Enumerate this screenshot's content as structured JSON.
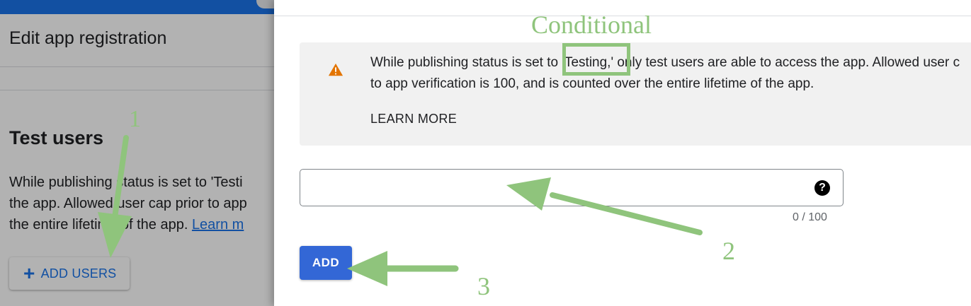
{
  "left_page": {
    "title": "Edit app registration",
    "section_title": "Test users",
    "description_lines": [
      "While publishing status is set to 'Testi",
      "the app. Allowed user cap prior to app",
      "the entire lifetime of the app. "
    ],
    "learn_more_link": "Learn m",
    "add_users_label": "ADD USERS"
  },
  "drawer": {
    "notice_lines": [
      "While publishing status is set to 'Testing,' only test users are able to access the app. Allowed user c",
      "to app verification is 100, and is counted over the entire lifetime of the app."
    ],
    "learn_more_label": "LEARN MORE",
    "input_value": "",
    "char_counter": "0 / 100",
    "add_label": "ADD"
  },
  "annotations": {
    "conditional": "Conditional",
    "step1": "1",
    "step2": "2",
    "step3": "3",
    "color": "#8fc47c"
  },
  "colors": {
    "accent": "#1a73e8",
    "add_button": "#3367d6",
    "warning": "#e37400",
    "notice_bg": "#f1f1f1"
  },
  "icons": [
    "plus-icon",
    "warning-icon",
    "help-icon"
  ]
}
